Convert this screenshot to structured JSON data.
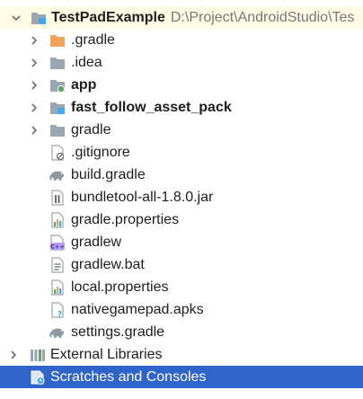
{
  "colors": {
    "folder_gray": "#9aa7b0",
    "folder_orange": "#f0a35b",
    "row_highlight": "#fefbe4",
    "selected_bg": "#2f65ca",
    "module_dot_green": "#59a869",
    "module_dot_blue": "#40a9f0"
  },
  "tree": {
    "root": {
      "label": "TestPadExample",
      "path": "D:\\Project\\AndroidStudio\\Tes",
      "icon": "module-folder-icon"
    },
    "items": [
      {
        "label": ".gradle",
        "icon": "folder-orange-icon"
      },
      {
        "label": ".idea",
        "icon": "folder-icon"
      },
      {
        "label": "app",
        "icon": "android-module-folder-icon"
      },
      {
        "label": "fast_follow_asset_pack",
        "icon": "asset-module-folder-icon"
      },
      {
        "label": "gradle",
        "icon": "folder-icon"
      },
      {
        "label": ".gitignore",
        "icon": "ignored-file-icon"
      },
      {
        "label": "build.gradle",
        "icon": "gradle-elephant-icon"
      },
      {
        "label": "bundletool-all-1.8.0.jar",
        "icon": "jar-file-icon"
      },
      {
        "label": "gradle.properties",
        "icon": "properties-file-icon"
      },
      {
        "label": "gradlew",
        "icon": "cpp-shell-file-icon"
      },
      {
        "label": "gradlew.bat",
        "icon": "text-file-icon"
      },
      {
        "label": "local.properties",
        "icon": "properties-file-icon"
      },
      {
        "label": "nativegamepad.apks",
        "icon": "unknown-file-icon"
      },
      {
        "label": "settings.gradle",
        "icon": "gradle-elephant-icon"
      }
    ],
    "external_libraries": {
      "label": "External Libraries",
      "icon": "library-icon"
    },
    "scratches": {
      "label": "Scratches and Consoles",
      "icon": "scratches-icon"
    }
  }
}
